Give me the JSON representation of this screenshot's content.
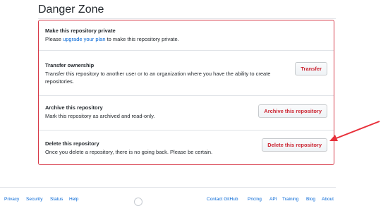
{
  "title": "Danger Zone",
  "rows": [
    {
      "title": "Make this repository private",
      "desc_before": "Please ",
      "desc_link": "upgrade your plan",
      "desc_after": " to make this repository private."
    },
    {
      "title": "Transfer ownership",
      "desc": "Transfer this repository to another user or to an organization where you have the ability to create repositories.",
      "button": "Transfer"
    },
    {
      "title": "Archive this repository",
      "desc": "Mark this repository as archived and read-only.",
      "button": "Archive this repository"
    },
    {
      "title": "Delete this repository",
      "desc": "Once you delete a repository, there is no going back. Please be certain.",
      "button": "Delete this repository"
    }
  ],
  "footer": {
    "left_links": [
      "Privacy",
      "Security",
      "Status",
      "Help"
    ],
    "right_links": [
      "Contact GitHub",
      "Pricing",
      "API",
      "Training",
      "Blog",
      "About"
    ],
    "logo_icon": "github-mark-icon"
  },
  "annotation": {
    "icon": "red-arrow-icon",
    "color": "#e8303a"
  },
  "colors": {
    "danger": "#d73a49",
    "danger_text": "#cb2431",
    "link": "#0366d6"
  }
}
